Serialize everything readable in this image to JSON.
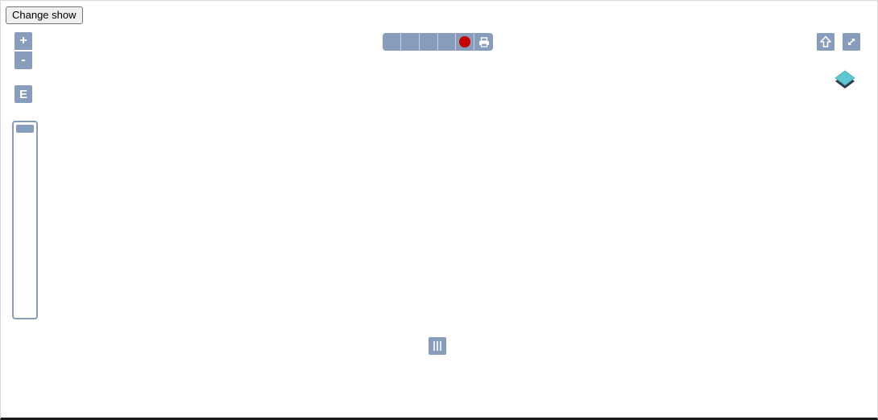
{
  "change_button": {
    "label": "Change show"
  },
  "zoom": {
    "in_label": "+",
    "out_label": "-"
  },
  "e_button": {
    "label": "E"
  },
  "slider": {
    "value": 1.0
  },
  "toolbar": {
    "segments": [
      "blank-tool",
      "blank-tool",
      "blank-tool",
      "blank-tool",
      "record-icon",
      "print-icon"
    ],
    "record_color": "#c40000"
  },
  "map_controls": {
    "home_icon": "home-icon",
    "expand_icon": "expand-icon",
    "layers_icon": "layers-icon"
  },
  "bottom_panel": {
    "icon": "panel-handle-icon"
  },
  "colors": {
    "control": "#879dbb",
    "layers_top": "#5cc6d1",
    "layers_bottom": "#2f3a44"
  }
}
